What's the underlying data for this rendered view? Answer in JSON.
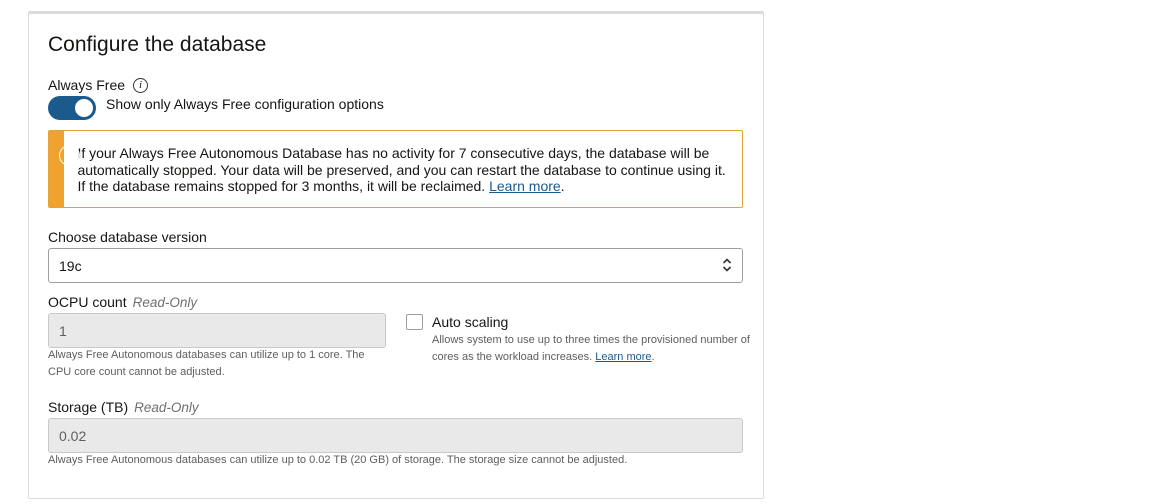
{
  "section": {
    "title": "Configure the database"
  },
  "always_free": {
    "label": "Always Free",
    "info_icon": "i",
    "toggle_on": true,
    "toggle_label": "Show only Always Free configuration options"
  },
  "alert": {
    "icon": "!",
    "text": "If your Always Free Autonomous Database has no activity for 7 consecutive days, the database will be automatically stopped. Your data will be preserved, and you can restart the database to continue using it. If the database remains stopped for 3 months, it will be reclaimed.",
    "link": "Learn more",
    "after_link": "."
  },
  "version": {
    "label": "Choose database version",
    "value": "19c"
  },
  "ocpu": {
    "label": "OCPU count",
    "readonly": "Read-Only",
    "value": "1",
    "help_line1": "Always Free Autonomous databases can utilize up to 1 core. The",
    "help_line2": "CPU core count cannot be adjusted."
  },
  "autoscaling": {
    "label": "Auto scaling",
    "checked": false,
    "help_line1": "Allows system to use up to three times the provisioned number of",
    "help_line2": "cores as the workload increases.",
    "link": "Learn more",
    "after_link": "."
  },
  "storage": {
    "label": "Storage (TB)",
    "readonly": "Read-Only",
    "value": "0.02",
    "help": "Always Free Autonomous databases can utilize up to 0.02 TB (20 GB) of storage. The storage size cannot be adjusted."
  },
  "colors": {
    "accent": "#1b5a8c",
    "warning": "#f0a22e"
  }
}
